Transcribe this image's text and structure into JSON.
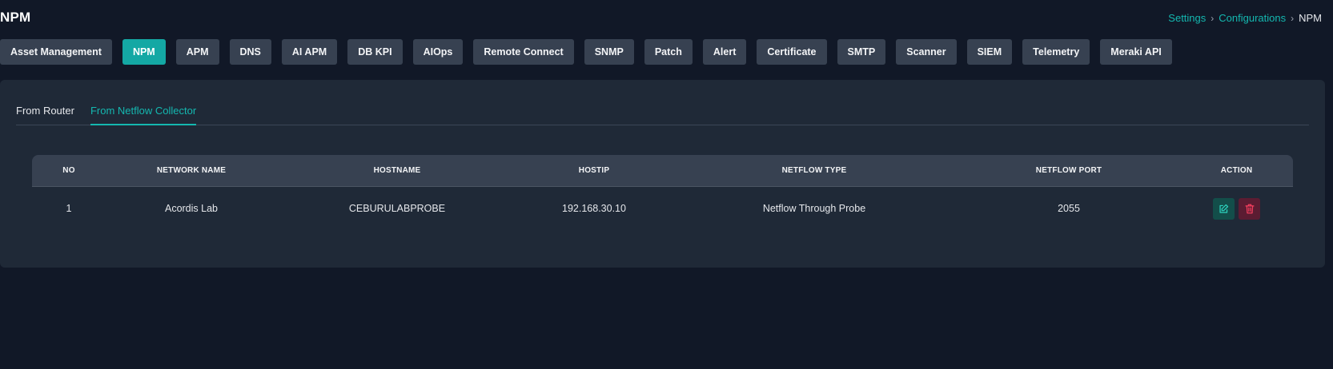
{
  "page": {
    "title": "NPM"
  },
  "breadcrumb": {
    "items": [
      "Settings",
      "Configurations"
    ],
    "current": "NPM",
    "separator": "›"
  },
  "module_tabs": [
    "Asset Management",
    "NPM",
    "APM",
    "DNS",
    "AI APM",
    "DB KPI",
    "AIOps",
    "Remote Connect",
    "SNMP",
    "Patch",
    "Alert",
    "Certificate",
    "SMTP",
    "Scanner",
    "SIEM",
    "Telemetry",
    "Meraki API"
  ],
  "active_module_tab": "NPM",
  "sub_tabs": [
    "From Router",
    "From Netflow Collector"
  ],
  "active_sub_tab": "From Netflow Collector",
  "table": {
    "columns": [
      "NO",
      "NETWORK NAME",
      "HOSTNAME",
      "HOSTIP",
      "NETFLOW TYPE",
      "NETFLOW PORT",
      "ACTION"
    ],
    "rows": [
      {
        "no": "1",
        "network_name": "Acordis Lab",
        "hostname": "CEBURULABPROBE",
        "hostip": "192.168.30.10",
        "netflow_type": "Netflow Through Probe",
        "netflow_port": "2055",
        "actions": [
          "edit-icon",
          "trash-icon"
        ]
      }
    ]
  },
  "colors": {
    "background": "#111827",
    "panel": "#1f2937",
    "accent": "#14a8a4",
    "button": "#374151",
    "edit_button": "#134e4a",
    "delete_button": "#5b1c32"
  }
}
